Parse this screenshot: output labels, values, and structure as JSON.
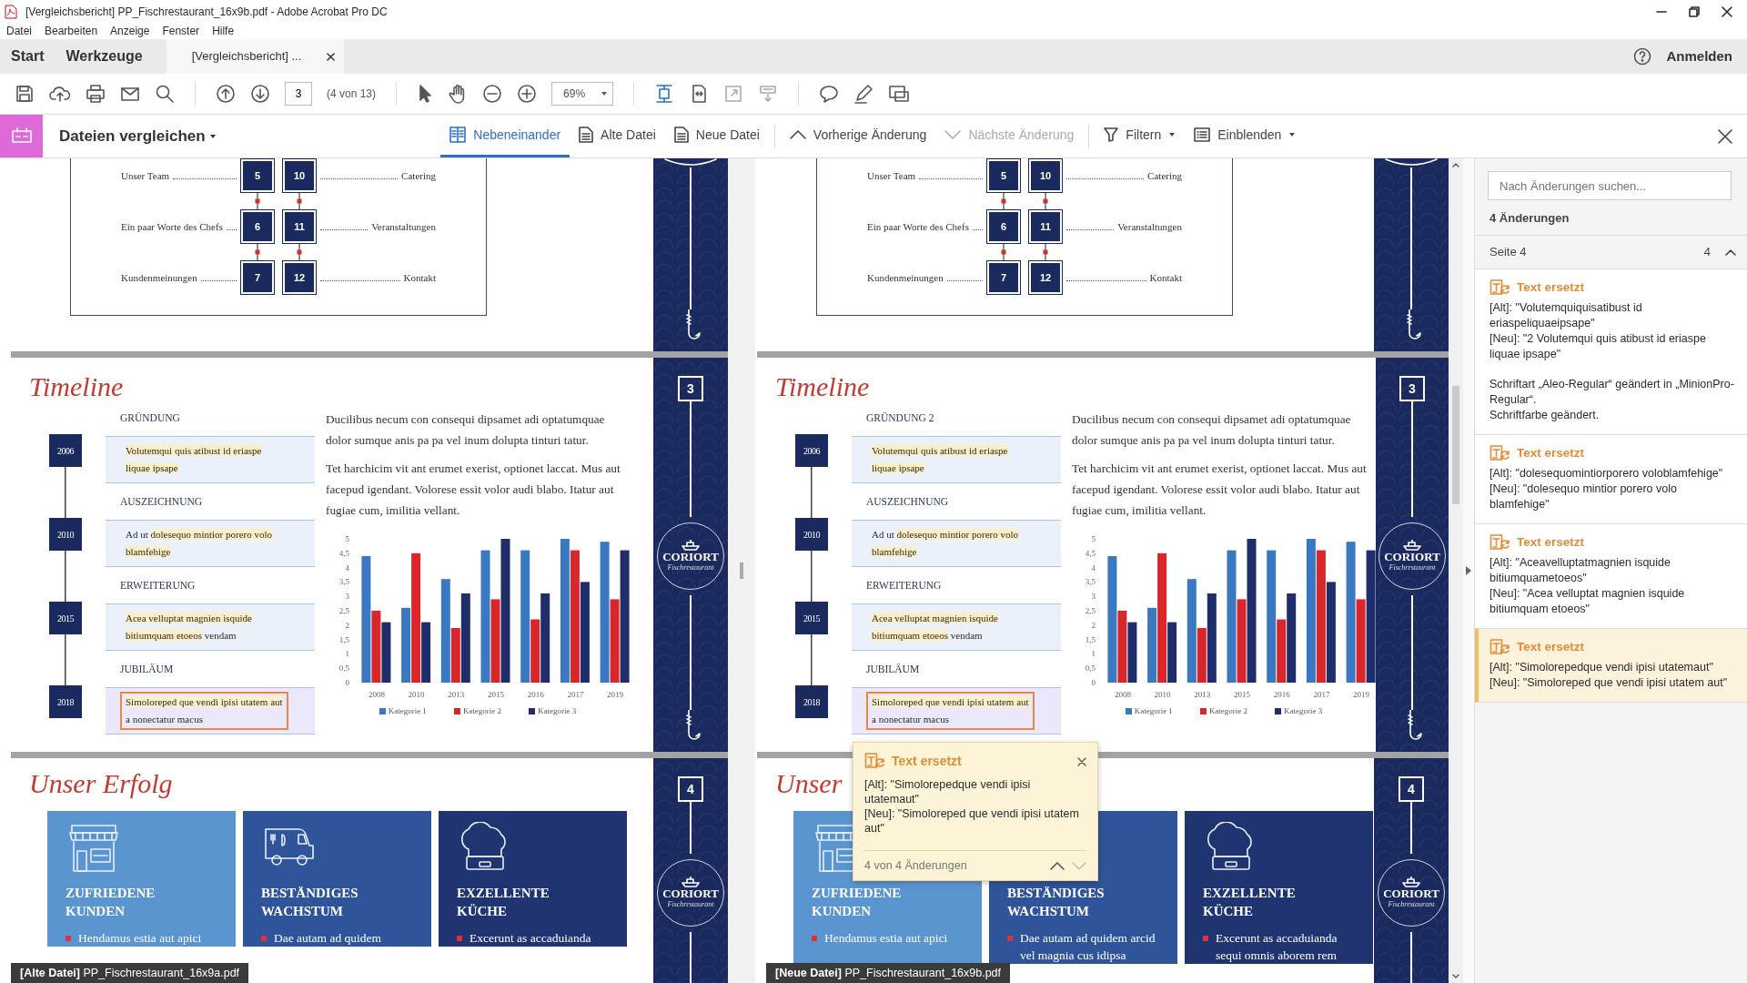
{
  "window": {
    "title": "[Vergleichsbericht] PP_Fischrestaurant_16x9b.pdf - Adobe Acrobat Pro DC"
  },
  "menu": [
    "Datei",
    "Bearbeiten",
    "Anzeige",
    "Fenster",
    "Hilfe"
  ],
  "tabs": [
    {
      "label": "Start",
      "kind": "home",
      "selected": false
    },
    {
      "label": "Werkzeuge",
      "kind": "home",
      "selected": false
    },
    {
      "label": "[Vergleichsbericht] ...",
      "kind": "document",
      "selected": true
    }
  ],
  "account": {
    "label": "Anmelden"
  },
  "toolbar": {
    "page": "3",
    "page_count": "(4 von 13)",
    "zoom": "69%"
  },
  "compare_bar": {
    "title": "Dateien vergleichen",
    "views": [
      {
        "label": "Nebeneinander",
        "selected": true
      },
      {
        "label": "Alte Datei",
        "selected": false
      },
      {
        "label": "Neue Datei",
        "selected": false
      }
    ],
    "navigation": [
      {
        "label": "Vorherige Änderung",
        "disabled": false
      },
      {
        "label": "Nächste Änderung",
        "disabled": true
      }
    ],
    "menus": [
      "Filtern",
      "Einblenden"
    ]
  },
  "documents": [
    {
      "label": "**[Alte Datei]** PP_Fischrestaurant_16x9a.pdf",
      "contents": {
        "left": [
          {
            "title": "Unser Team",
            "page": "5"
          },
          {
            "title": "Ein paar Worte des Chefs",
            "page": "6"
          },
          {
            "title": "Kundenmeinungen",
            "page": "7"
          }
        ],
        "right": [
          {
            "page": "10",
            "title": "Catering"
          },
          {
            "page": "11",
            "title": "Veranstaltungen"
          },
          {
            "page": "12",
            "title": "Kontakt"
          }
        ]
      },
      "timeline": {
        "title": "Timeline",
        "page": "3",
        "logo": {
          "name": "CORIORT",
          "tagline": "Fischrestaurant"
        },
        "entries": [
          {
            "year": "2006",
            "heading": "GRÜNDUNG",
            "selected": false,
            "parts": [
              {
                "text": "Volutemqui quis atibust id eriaspe liquae ipsape",
                "changed": true
              }
            ]
          },
          {
            "year": "2010",
            "heading": "AUSZEICHNUNG",
            "selected": false,
            "parts": [
              {
                "text": "Ad ut ",
                "changed": false
              },
              {
                "text": "dolesequo mintior porero volo blamfehige",
                "changed": true
              }
            ]
          },
          {
            "year": "2015",
            "heading": "ERWEITERUNG",
            "selected": false,
            "parts": [
              {
                "text": "Acea velluptat magnien isquide bitiumquam etoeos",
                "changed": true
              },
              {
                "text": " vendam",
                "changed": false
              }
            ]
          },
          {
            "year": "2018",
            "heading": "JUBILÄUM",
            "selected": true,
            "parts": [
              {
                "text": "Simoloreped que vendi ipisi utatem aut",
                "changed": true
              },
              {
                "text": " a nonectatur macus",
                "changed": false
              }
            ]
          }
        ],
        "paragraphs": [
          "Ducilibus necum con consequi dipsamet adi optatumquae dolor sumque anis pa pa vel inum dolupta tinturi tatur.",
          "Tet harchicim vit ant erumet exerist, optionet laccat. Mus aut facepud igendant. Volorese essit volor audi blabo. Itatur aut fugiae cum, imilitia vellant."
        ],
        "chart_data": {
          "type": "bar",
          "categories": [
            "2008",
            "2010",
            "2013",
            "2015",
            "2016",
            "2017",
            "2019"
          ],
          "series": [
            {
              "name": "Kategorie 1",
              "color": "#3a78c2",
              "values": [
                4.4,
                2.6,
                3.6,
                4.6,
                4.6,
                5.0,
                4.9
              ]
            },
            {
              "name": "Kategorie 2",
              "color": "#d9262b",
              "values": [
                2.5,
                4.5,
                1.9,
                2.9,
                2.2,
                4.6,
                2.9
              ]
            },
            {
              "name": "Kategorie 3",
              "color": "#1f2d6b",
              "values": [
                2.1,
                2.1,
                3.1,
                5.0,
                3.1,
                3.5,
                4.6
              ]
            }
          ],
          "legend": "bottom",
          "ylim": [
            0,
            5
          ],
          "yticks": [
            0,
            {
              "value": 0.5,
              "label": "0,5"
            },
            1,
            {
              "value": 1.5,
              "label": "1,5"
            },
            2,
            {
              "value": 2.5,
              "label": "2,5"
            },
            3,
            {
              "value": 3.5,
              "label": "3,5"
            },
            4,
            {
              "value": 4.5,
              "label": "4,5"
            },
            5
          ]
        }
      },
      "success": {
        "title": "Unser Erfolg",
        "page": "4",
        "logo": {
          "name": "CORIORT",
          "tagline": "Fischrestaurant"
        },
        "cards": [
          {
            "kind": "shop",
            "heading": "ZUFRIEDENE KUNDEN",
            "color": "#5b95cf",
            "bullets": [
              "Hendamus estia aut apici"
            ]
          },
          {
            "kind": "truck",
            "heading": "BESTÄNDIGES WACHSTUM",
            "color": "#30549a",
            "bullets": [
              "Dae autam ad quidem"
            ]
          },
          {
            "kind": "kitchen",
            "heading": "EXZELLENTE KÜCHE",
            "color": "#1f3471",
            "bullets": [
              "Excerunt as accaduianda"
            ]
          }
        ]
      }
    },
    {
      "label": "**[Neue Datei]** PP_Fischrestaurant_16x9b.pdf",
      "contents": {
        "left": [
          {
            "title": "Unser Team",
            "page": "5"
          },
          {
            "title": "Ein paar Worte des Chefs",
            "page": "6"
          },
          {
            "title": "Kundenmeinungen",
            "page": "7"
          }
        ],
        "right": [
          {
            "page": "10",
            "title": "Catering"
          },
          {
            "page": "11",
            "title": "Veranstaltungen"
          },
          {
            "page": "12",
            "title": "Kontakt"
          }
        ]
      },
      "timeline": {
        "title": "Timeline",
        "page": "3",
        "logo": {
          "name": "CORIORT",
          "tagline": "Fischrestaurant"
        },
        "entries": [
          {
            "year": "2006",
            "heading": "GRÜNDUNG 2",
            "selected": false,
            "parts": [
              {
                "text": "Volutemqui quis atibust id eriaspe liquae ipsape",
                "changed": true
              }
            ]
          },
          {
            "year": "2010",
            "heading": "AUSZEICHNUNG",
            "selected": false,
            "parts": [
              {
                "text": "Ad ut ",
                "changed": false
              },
              {
                "text": "dolesequo mintior porero volo blamfehige",
                "changed": true
              }
            ]
          },
          {
            "year": "2015",
            "heading": "ERWEITERUNG",
            "selected": false,
            "parts": [
              {
                "text": "Acea velluptat magnien isquide bitiumquam etoeos",
                "changed": true
              },
              {
                "text": " vendam",
                "changed": false
              }
            ]
          },
          {
            "year": "2018",
            "heading": "JUBILÄUM",
            "selected": true,
            "parts": [
              {
                "text": "Simoloreped que vendi ipisi utatem aut",
                "changed": true
              },
              {
                "text": " a nonectatur macus",
                "changed": false
              }
            ]
          }
        ],
        "paragraphs": [
          "Ducilibus necum con consequi dipsamet adi optatumquae dolor sumque anis pa pa vel inum dolupta tinturi tatur.",
          "Tet harchicim vit ant erumet exerist, optionet laccat. Mus aut facepud igendant. Volorese essit volor audi blabo. Itatur aut fugiae cum, imilitia vellant."
        ],
        "chart_data": {
          "type": "bar",
          "categories": [
            "2008",
            "2010",
            "2013",
            "2015",
            "2016",
            "2017",
            "2019"
          ],
          "series": [
            {
              "name": "Kategorie 1",
              "color": "#3a78c2",
              "values": [
                4.4,
                2.6,
                3.6,
                4.6,
                4.6,
                5.0,
                4.9
              ]
            },
            {
              "name": "Kategorie 2",
              "color": "#d9262b",
              "values": [
                2.5,
                4.5,
                1.9,
                2.9,
                2.2,
                4.6,
                2.9
              ]
            },
            {
              "name": "Kategorie 3",
              "color": "#1f2d6b",
              "values": [
                2.1,
                2.1,
                3.1,
                5.0,
                3.1,
                3.5,
                4.6
              ]
            }
          ],
          "legend": "bottom",
          "ylim": [
            0,
            5
          ],
          "yticks": [
            0,
            {
              "value": 0.5,
              "label": "0,5"
            },
            1,
            {
              "value": 1.5,
              "label": "1,5"
            },
            2,
            {
              "value": 2.5,
              "label": "2,5"
            },
            3,
            {
              "value": 3.5,
              "label": "3,5"
            },
            4,
            {
              "value": 4.5,
              "label": "4,5"
            },
            5
          ]
        }
      },
      "success": {
        "title": "Unser",
        "page": "4",
        "logo": {
          "name": "CORIORT",
          "tagline": "Fischrestaurant"
        },
        "cards": [
          {
            "kind": "shop",
            "heading": "ZUFRIEDENE KUNDEN",
            "color": "#5b95cf",
            "bullets": [
              "Hendamus estia aut apici"
            ]
          },
          {
            "heading": "BESTÄNDIGES WACHSTUM",
            "color": "#30549a",
            "bullets": [
              "Dae autam ad quidem arcid vel magnia cus idipsa"
            ]
          },
          {
            "kind": "kitchen",
            "heading": "EXZELLENTE KÜCHE",
            "color": "#1f3471",
            "bullets": [
              "Excerunt as accaduianda sequi omnis aborem rem"
            ]
          }
        ]
      }
    }
  ],
  "tooltip": {
    "title": "Text ersetzt",
    "old": "[Alt]: \"Simolorepedque vendi ipisi utatemaut\"",
    "new": "[Neu]: \"Simoloreped que vendi ipisi utatem aut\"",
    "position": "4 von 4 Änderungen",
    "navigation": [
      {
        "disabled": false
      },
      {
        "disabled": true
      }
    ]
  },
  "changes_panel": {
    "search": {
      "placeholder": "Nach Änderungen suchen..."
    },
    "summary": "4 Änderungen",
    "groups": [
      {
        "label": "Seite 4",
        "count": "4",
        "expanded": true,
        "changes": [
          {
            "title": "Text ersetzt",
            "old": "[Alt]: \"Volutemquiquisatibust id eriaspeliquaeipsape\"",
            "new": "[Neu]: \"2 Volutemqui quis atibust id eriaspe liquae ipsape\"",
            "notes": [
              "Schriftart „Aleo-Regular“ geändert in „MinionPro-Regular“.",
              "Schriftfarbe geändert."
            ],
            "selected": false
          },
          {
            "title": "Text ersetzt",
            "old": "[Alt]: \"dolesequomintiorporero voloblamfehige\"",
            "new": "[Neu]: \"dolesequo mintior porero volo blamfehige\"",
            "selected": false
          },
          {
            "title": "Text ersetzt",
            "old": "[Alt]: \"Aceavelluptatmagnien isquide bitiumquametoeos\"",
            "new": "[Neu]: \"Acea velluptat magnien isquide bitiumquam etoeos\"",
            "selected": false
          },
          {
            "title": "Text ersetzt",
            "old": "[Alt]: \"Simolorepedque vendi ipisi utatemaut\"",
            "new": "[Neu]: \"Simoloreped que vendi ipisi utatem aut\"",
            "selected": true
          }
        ]
      }
    ]
  }
}
